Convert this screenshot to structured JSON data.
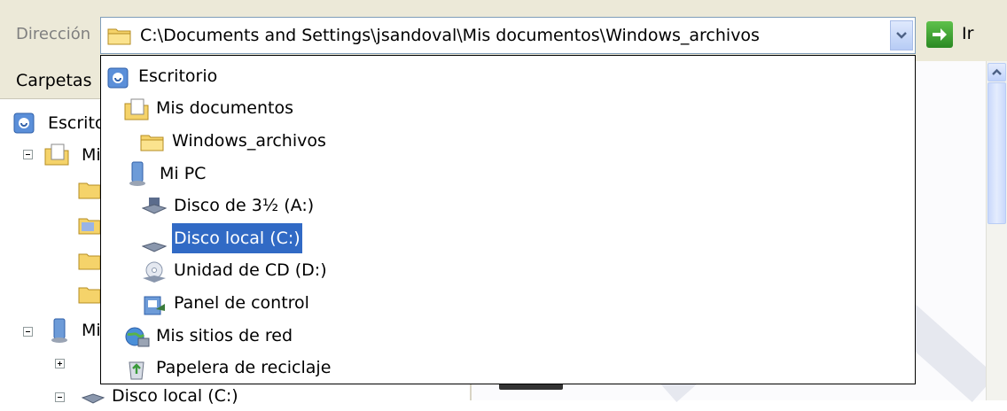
{
  "address_bar": {
    "label": "Dirección",
    "path": "C:\\Documents and Settings\\jsandoval\\Mis documentos\\Windows_archivos",
    "go_label": "Ir"
  },
  "folder_pane": {
    "title": "Carpetas",
    "tree": [
      {
        "label": "Escrito",
        "icon": "desktop-icon"
      },
      {
        "label": "Mi",
        "icon": "my-documents-icon"
      },
      {
        "label": "Mi",
        "icon": "my-computer-icon"
      },
      {
        "label": "Disco local (C:)",
        "icon": "hard-drive-icon"
      }
    ]
  },
  "dropdown": {
    "items": [
      {
        "label": "Escritorio",
        "icon": "desktop-icon",
        "indent": 0
      },
      {
        "label": "Mis documentos",
        "icon": "my-documents-icon",
        "indent": 1
      },
      {
        "label": "Windows_archivos",
        "icon": "folder-icon",
        "indent": 2
      },
      {
        "label": "Mi PC",
        "icon": "my-computer-icon",
        "indent": 1
      },
      {
        "label": "Disco de 3½ (A:)",
        "icon": "floppy-drive-icon",
        "indent": 2
      },
      {
        "label": "Disco local (C:)",
        "icon": "hard-drive-icon",
        "indent": 2,
        "selected": true
      },
      {
        "label": "Unidad de CD (D:)",
        "icon": "cd-drive-icon",
        "indent": 2
      },
      {
        "label": "Panel de control",
        "icon": "control-panel-icon",
        "indent": 2
      },
      {
        "label": "Mis sitios de red",
        "icon": "network-places-icon",
        "indent": 1
      },
      {
        "label": "Papelera de reciclaje",
        "icon": "recycle-bin-icon",
        "indent": 1
      }
    ]
  },
  "colors": {
    "selection": "#316ac5",
    "chrome": "#ece9d8",
    "combo_border": "#7f9db9"
  }
}
